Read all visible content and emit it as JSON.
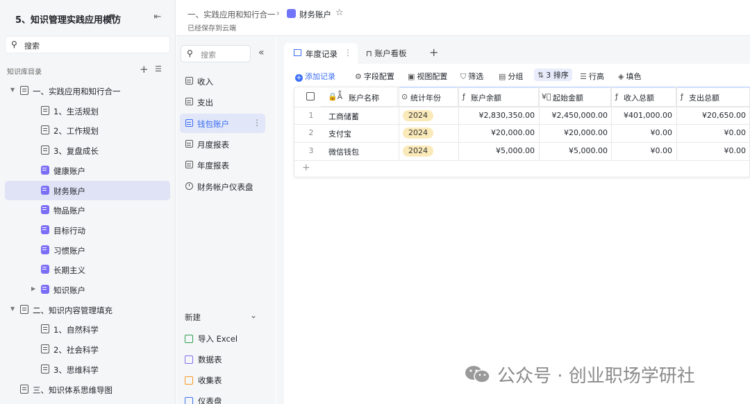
{
  "sidebar": {
    "kb_title": "5、知识管理实践应用模仿",
    "search_placeholder": "搜索",
    "toc_label": "知识库目录",
    "items": [
      {
        "label": "一、实践应用和知行合一",
        "level": 0,
        "expanded": true,
        "icon": "doc-icon"
      },
      {
        "label": "1、生活规划",
        "level": 1,
        "icon": "doc-icon"
      },
      {
        "label": "2、工作规划",
        "level": 1,
        "icon": "doc-icon"
      },
      {
        "label": "3、复盘成长",
        "level": 1,
        "icon": "doc-icon"
      },
      {
        "label": "健康账户",
        "level": 1,
        "icon": "heart-icon"
      },
      {
        "label": "财务账户",
        "level": 1,
        "icon": "table-icon",
        "active": true
      },
      {
        "label": "物品账户",
        "level": 1,
        "icon": "sheet-icon"
      },
      {
        "label": "目标行动",
        "level": 1,
        "icon": "target-icon"
      },
      {
        "label": "习惯账户",
        "level": 1,
        "icon": "habit-icon"
      },
      {
        "label": "长期主义",
        "level": 1,
        "icon": "chart-icon"
      },
      {
        "label": "知识账户",
        "level": 1,
        "expanded": false,
        "icon": "book-icon"
      },
      {
        "label": "二、知识内容管理填充",
        "level": 0,
        "expanded": true,
        "icon": "doc-icon"
      },
      {
        "label": "1、自然科学",
        "level": 1,
        "icon": "doc-icon"
      },
      {
        "label": "2、社会科学",
        "level": 1,
        "icon": "doc-icon"
      },
      {
        "label": "3、思维科学",
        "level": 1,
        "icon": "doc-icon"
      },
      {
        "label": "三、知识体系思维导图",
        "level": 0,
        "icon": "doc-icon"
      }
    ]
  },
  "header": {
    "breadcrumb_parent": "一、实践应用和知行合一",
    "breadcrumb_current": "财务账户",
    "save_status": "已经保存到云端"
  },
  "tables_panel": {
    "search_placeholder": "搜索",
    "tables": [
      {
        "label": "收入",
        "icon": "table-icon"
      },
      {
        "label": "支出",
        "icon": "table-icon"
      },
      {
        "label": "钱包账户",
        "icon": "table-icon",
        "active": true
      },
      {
        "label": "月度报表",
        "icon": "table-icon"
      },
      {
        "label": "年度报表",
        "icon": "table-icon"
      },
      {
        "label": "财务帐户仪表盘",
        "icon": "dashboard-icon"
      }
    ],
    "new_label": "新建",
    "new_items": [
      {
        "label": "导入 Excel",
        "color": "#2e9e4f"
      },
      {
        "label": "数据表",
        "color": "#7b6ef6"
      },
      {
        "label": "收集表",
        "color": "#f59a23"
      },
      {
        "label": "仪表盘",
        "color": "#3b6ef5"
      }
    ]
  },
  "views": {
    "tabs": [
      {
        "label": "年度记录",
        "active": true
      },
      {
        "label": "账户看板"
      }
    ]
  },
  "toolbar": {
    "add_record": "添加记录",
    "field_config": "字段配置",
    "view_config": "视图配置",
    "filter": "筛选",
    "group": "分组",
    "sort": "3 排序",
    "row_height": "行高",
    "fill_color": "填色"
  },
  "grid": {
    "columns": [
      "账户名称",
      "统计年份",
      "账户余额",
      "起始金额",
      "收入总额",
      "支出总额"
    ],
    "rows": [
      {
        "idx": "1",
        "name": "工商储蓄",
        "year": "2024",
        "balance": "¥2,830,350.00",
        "start": "¥2,450,000.00",
        "income": "¥401,000.00",
        "expense": "¥20,650.00"
      },
      {
        "idx": "2",
        "name": "支付宝",
        "year": "2024",
        "balance": "¥20,000.00",
        "start": "¥20,000.00",
        "income": "¥0.00",
        "expense": "¥0.00"
      },
      {
        "idx": "3",
        "name": "微信钱包",
        "year": "2024",
        "balance": "¥5,000.00",
        "start": "¥5,000.00",
        "income": "¥0.00",
        "expense": "¥0.00"
      }
    ]
  },
  "watermark": "公众号 · 创业职场学研社",
  "colors": {
    "accent": "#3b6ef5",
    "year_tag": "#fbeab9",
    "active_bg": "#dfe3f5"
  }
}
